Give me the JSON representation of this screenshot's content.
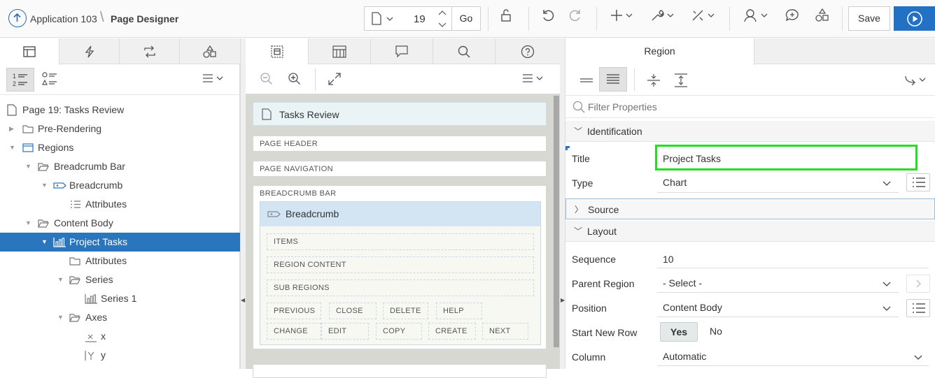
{
  "header": {
    "app_name": "Application 103",
    "separator": "\\",
    "page_designer": "Page Designer",
    "page_number": "19",
    "go_label": "Go",
    "save_label": "Save"
  },
  "left_panel": {
    "tree": [
      {
        "label": "Page 19: Tasks Review"
      },
      {
        "label": "Pre-Rendering"
      },
      {
        "label": "Regions"
      },
      {
        "label": "Breadcrumb Bar"
      },
      {
        "label": "Breadcrumb"
      },
      {
        "label": "Attributes"
      },
      {
        "label": "Content Body"
      },
      {
        "label": "Project Tasks"
      },
      {
        "label": "Attributes"
      },
      {
        "label": "Series"
      },
      {
        "label": "Series 1"
      },
      {
        "label": "Axes"
      },
      {
        "label": "x"
      },
      {
        "label": "y"
      }
    ]
  },
  "layout_panel": {
    "page_title": "Tasks Review",
    "page_header": "PAGE HEADER",
    "page_navigation": "PAGE NAVIGATION",
    "breadcrumb_bar": "BREADCRUMB BAR",
    "breadcrumb_region": "Breadcrumb",
    "positions": [
      "ITEMS",
      "REGION CONTENT",
      "SUB REGIONS"
    ],
    "buttons_row1": [
      "PREVIOUS",
      "CLOSE",
      "DELETE",
      "HELP"
    ],
    "buttons_row2": [
      "CHANGE",
      "EDIT",
      "COPY",
      "CREATE",
      "NEXT"
    ]
  },
  "property_panel": {
    "tab_label": "Region",
    "filter_placeholder": "Filter Properties",
    "groups": {
      "identification": "Identification",
      "source": "Source",
      "layout": "Layout"
    },
    "props": {
      "title_label": "Title",
      "title_value": "Project Tasks",
      "type_label": "Type",
      "type_value": "Chart",
      "sequence_label": "Sequence",
      "sequence_value": "10",
      "parent_label": "Parent Region",
      "parent_value": "- Select -",
      "position_label": "Position",
      "position_value": "Content Body",
      "newrow_label": "Start New Row",
      "newrow_yes": "Yes",
      "newrow_no": "No",
      "column_label": "Column",
      "column_value": "Automatic"
    }
  },
  "colors": {
    "accent": "#2976bf",
    "highlight_box": "#22e01d",
    "run_button": "#2371c5"
  }
}
